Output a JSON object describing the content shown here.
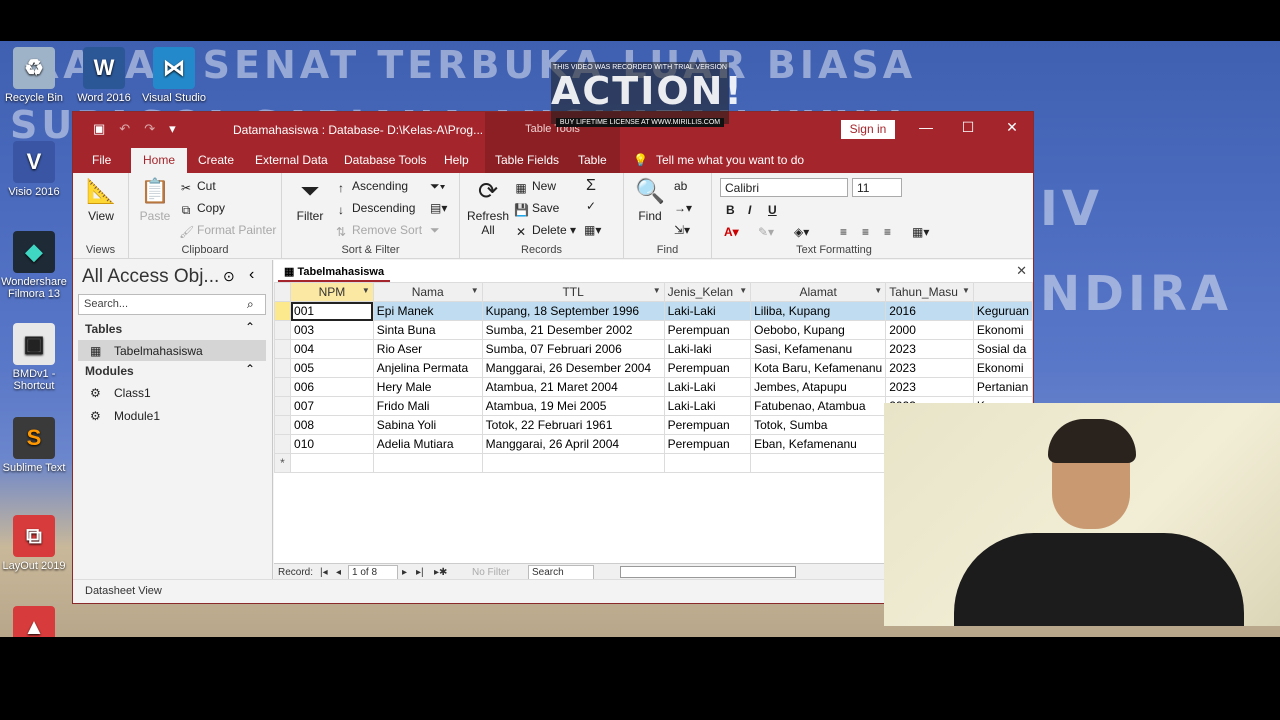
{
  "desktop": {
    "banner_lines": [
      "RAPAT SENAT TERBUKA LUAR BIASA",
      "SUPASCA SARJANA ANGKATAN XXXV",
      "IV",
      "NDIRA"
    ],
    "icons": [
      {
        "label": "Recycle Bin",
        "icon": "recycle-bin-icon"
      },
      {
        "label": "Word 2016",
        "icon": "word-icon"
      },
      {
        "label": "Visual Studio",
        "icon": "visual-studio-icon"
      },
      {
        "label": "Visio 2016",
        "icon": "visio-icon"
      },
      {
        "label": "Wondershare Filmora 13",
        "icon": "filmora-icon"
      },
      {
        "label": "BMDv1 - Shortcut",
        "icon": "bmd-icon"
      },
      {
        "label": "Sublime Text",
        "icon": "sublime-icon"
      },
      {
        "label": "LayOut 2019",
        "icon": "layout-icon"
      }
    ]
  },
  "watermark": {
    "top": "THIS VIDEO WAS RECORDED WITH TRIAL VERSION",
    "brand": "ACTION!",
    "bottom": "BUY LIFETIME LICENSE AT WWW.MIRILLIS.COM"
  },
  "window": {
    "title": "Datamahasiswa : Database- D:\\Kelas-A\\Prog...",
    "context_title": "Table Tools",
    "sign_in": "Sign in",
    "controls": {
      "minimize": "—",
      "restore": "☐",
      "close": "✕"
    }
  },
  "tabs": [
    "File",
    "Home",
    "Create",
    "External Data",
    "Database Tools",
    "Help",
    "Table Fields",
    "Table"
  ],
  "tell_me": "Tell me what you want to do",
  "ribbon": {
    "views": {
      "view": "View",
      "label": "Views"
    },
    "clipboard": {
      "paste": "Paste",
      "cut": "Cut",
      "copy": "Copy",
      "format_painter": "Format Painter",
      "label": "Clipboard"
    },
    "sort_filter": {
      "filter": "Filter",
      "ascending": "Ascending",
      "descending": "Descending",
      "remove_sort": "Remove Sort",
      "label": "Sort & Filter"
    },
    "records": {
      "refresh": "Refresh",
      "all": "All",
      "new": "New",
      "save": "Save",
      "delete": "Delete",
      "label": "Records"
    },
    "find": {
      "find": "Find",
      "label": "Find"
    },
    "text_formatting": {
      "font": "Calibri",
      "size": "11",
      "bold": "B",
      "italic": "I",
      "underline": "U",
      "label": "Text Formatting"
    }
  },
  "nav_pane": {
    "title": "All Access Obj...",
    "search_placeholder": "Search...",
    "sections": [
      {
        "name": "Tables",
        "items": [
          "Tabelmahasiswa"
        ]
      },
      {
        "name": "Modules",
        "items": [
          "Class1",
          "Module1"
        ]
      }
    ]
  },
  "document": {
    "tab": "Tabelmahasiswa",
    "columns": [
      "NPM",
      "Nama",
      "TTL",
      "Jenis_Kelan",
      "Alamat",
      "Tahun_Masu",
      ""
    ],
    "rows": [
      [
        "001",
        "Epi Manek",
        "Kupang, 18 September 1996",
        "Laki-Laki",
        "Liliba, Kupang",
        "2016",
        "Keguruan"
      ],
      [
        "003",
        "Sinta Buna",
        "Sumba, 21 Desember 2002",
        "Perempuan",
        "Oebobo, Kupang",
        "2000",
        "Ekonomi"
      ],
      [
        "004",
        "Rio Aser",
        "Sumba, 07 Februari 2006",
        "Laki-laki",
        "Sasi, Kefamenanu",
        "2023",
        "Sosial da"
      ],
      [
        "005",
        "Anjelina Permata",
        "Manggarai, 26 Desember 2004",
        "Perempuan",
        "Kota Baru, Kefamenanu",
        "2023",
        "Ekonomi"
      ],
      [
        "006",
        "Hery Male",
        "Atambua, 21 Maret 2004",
        "Laki-Laki",
        "Jembes, Atapupu",
        "2023",
        "Pertanian"
      ],
      [
        "007",
        "Frido Mali",
        "Atambua, 19 Mei 2005",
        "Laki-Laki",
        "Fatubenao, Atambua",
        "2023",
        "Ke"
      ],
      [
        "008",
        "Sabina Yoli",
        "Totok, 22 Februari 1961",
        "Perempuan",
        "Totok, Sumba",
        "",
        ""
      ],
      [
        "010",
        "Adelia Mutiara",
        "Manggarai, 26 April 2004",
        "Perempuan",
        "Eban, Kefamenanu",
        "",
        ""
      ]
    ],
    "new_row_marker": "*",
    "record_nav": {
      "label": "Record:",
      "position": "1 of 8",
      "filter": "No Filter",
      "search": "Search"
    }
  },
  "status_bar": {
    "view": "Datasheet View"
  }
}
